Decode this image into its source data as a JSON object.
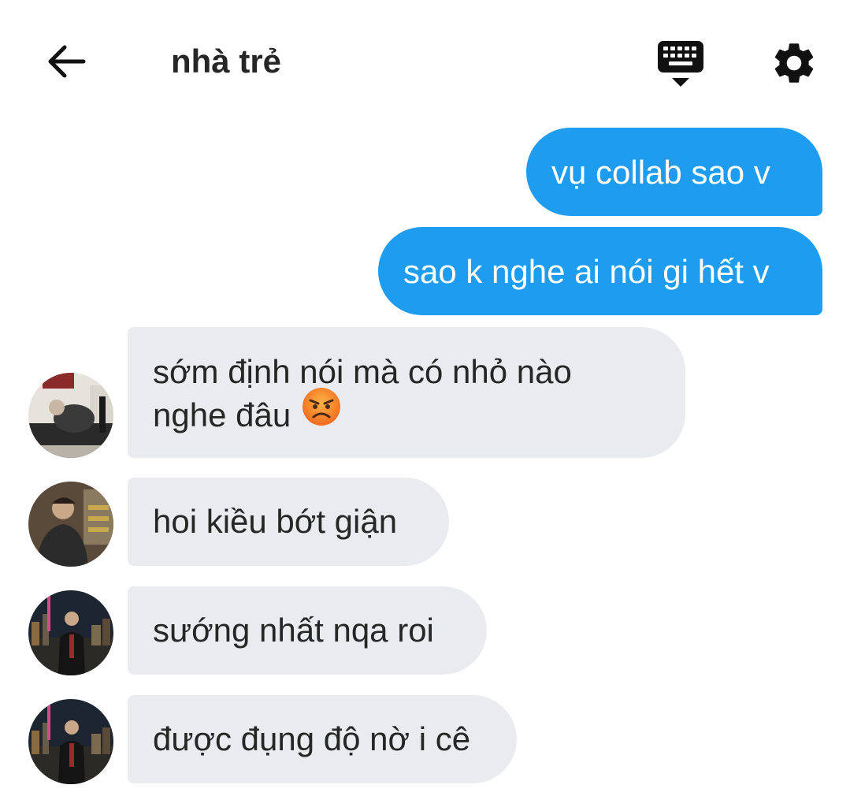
{
  "header": {
    "title": "nhà trẻ",
    "back_icon": "arrow-left-icon",
    "keyboard_icon": "keyboard-hide-icon",
    "settings_icon": "gear-icon"
  },
  "messages": [
    {
      "direction": "outgoing",
      "text": "vụ collab sao v"
    },
    {
      "direction": "outgoing",
      "text": "sao k nghe ai nói gi hết v"
    },
    {
      "direction": "incoming",
      "lines": [
        "sớm định nói mà có nhỏ nào",
        "nghe đâu"
      ],
      "emoji": "angry-face-emoji"
    },
    {
      "direction": "incoming",
      "text": "hoi kiều bớt giận"
    },
    {
      "direction": "incoming",
      "text": "sướng nhất nqa roi"
    },
    {
      "direction": "incoming",
      "text": "được đụng độ nờ i cê"
    }
  ],
  "colors": {
    "outgoing_bubble": "#1e9cf0",
    "incoming_bubble": "#e9ebef",
    "text_dark": "#262626"
  }
}
